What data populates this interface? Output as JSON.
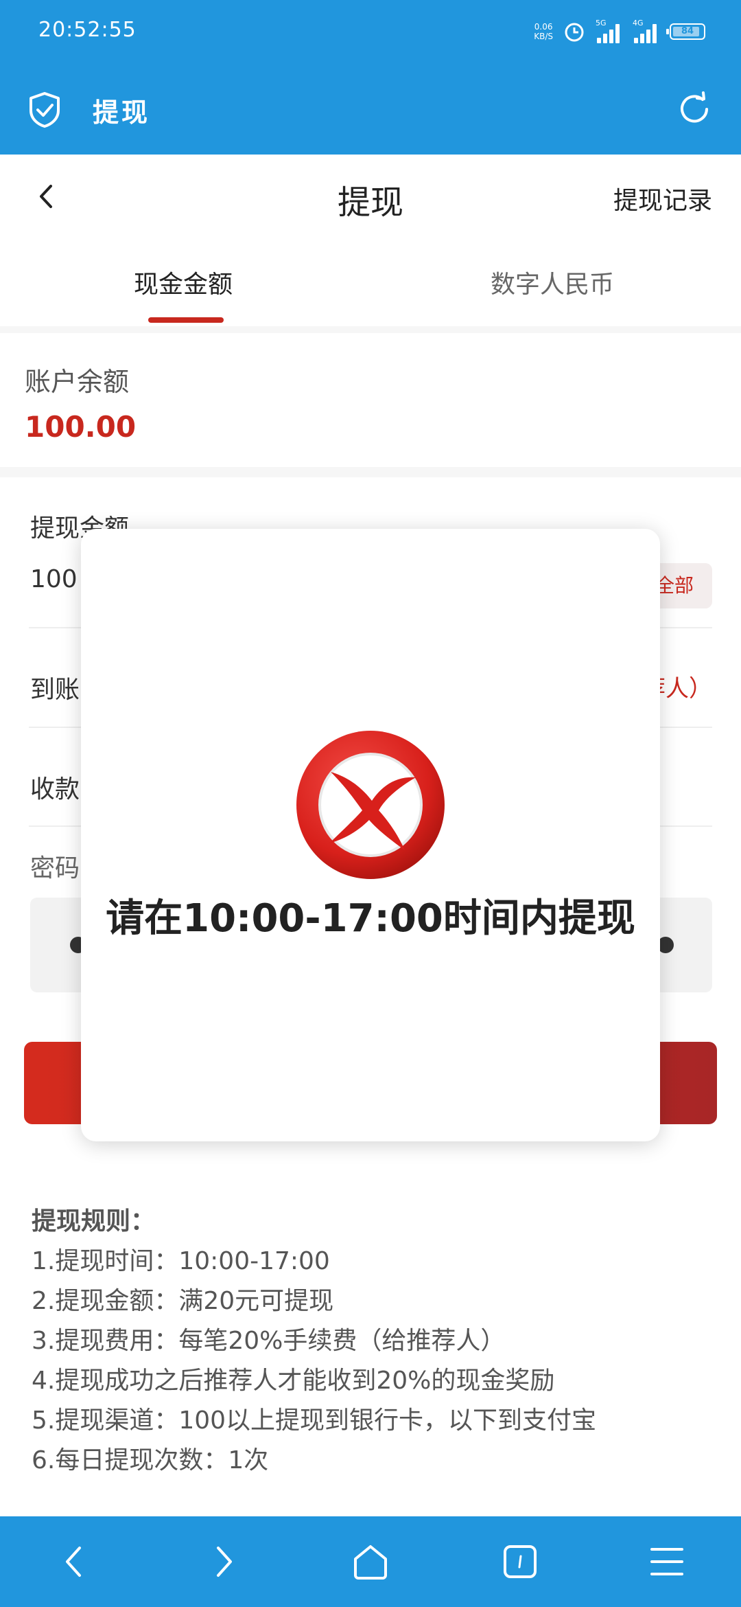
{
  "status_bar": {
    "time": "20:52:55",
    "net_speed_value": "0.06",
    "net_speed_unit": "KB/S",
    "signal1_label": "5G",
    "signal2_label": "4G",
    "battery": "84"
  },
  "app_bar": {
    "title": "提现"
  },
  "header": {
    "title": "提现",
    "history_link": "提现记录"
  },
  "tabs": [
    {
      "label": "现金金额",
      "active": true
    },
    {
      "label": "数字人民币",
      "active": false
    }
  ],
  "balance": {
    "label": "账户余额",
    "value": "100.00"
  },
  "form": {
    "amount_label": "提现金额",
    "amount_value": "100",
    "all_button": "全部",
    "arrival_label": "到账",
    "arrival_right_text": "荐人）",
    "payee_label": "收款",
    "password_label": "密码"
  },
  "modal": {
    "message": "请在10:00-17:00时间内提现",
    "icon": "error-x-icon"
  },
  "rules": {
    "title": "提现规则：",
    "items": [
      "1.提现时间：10:00-17:00",
      "2.提现金额：满20元可提现",
      "3.提现费用：每笔20%手续费（给推荐人）",
      "4.提现成功之后推荐人才能收到20%的现金奖励",
      "5.提现渠道：100以上提现到银行卡，以下到支付宝",
      "6.每日提现次数：1次"
    ]
  },
  "colors": {
    "primary_blue": "#2196dd",
    "accent_red": "#c8281e"
  }
}
